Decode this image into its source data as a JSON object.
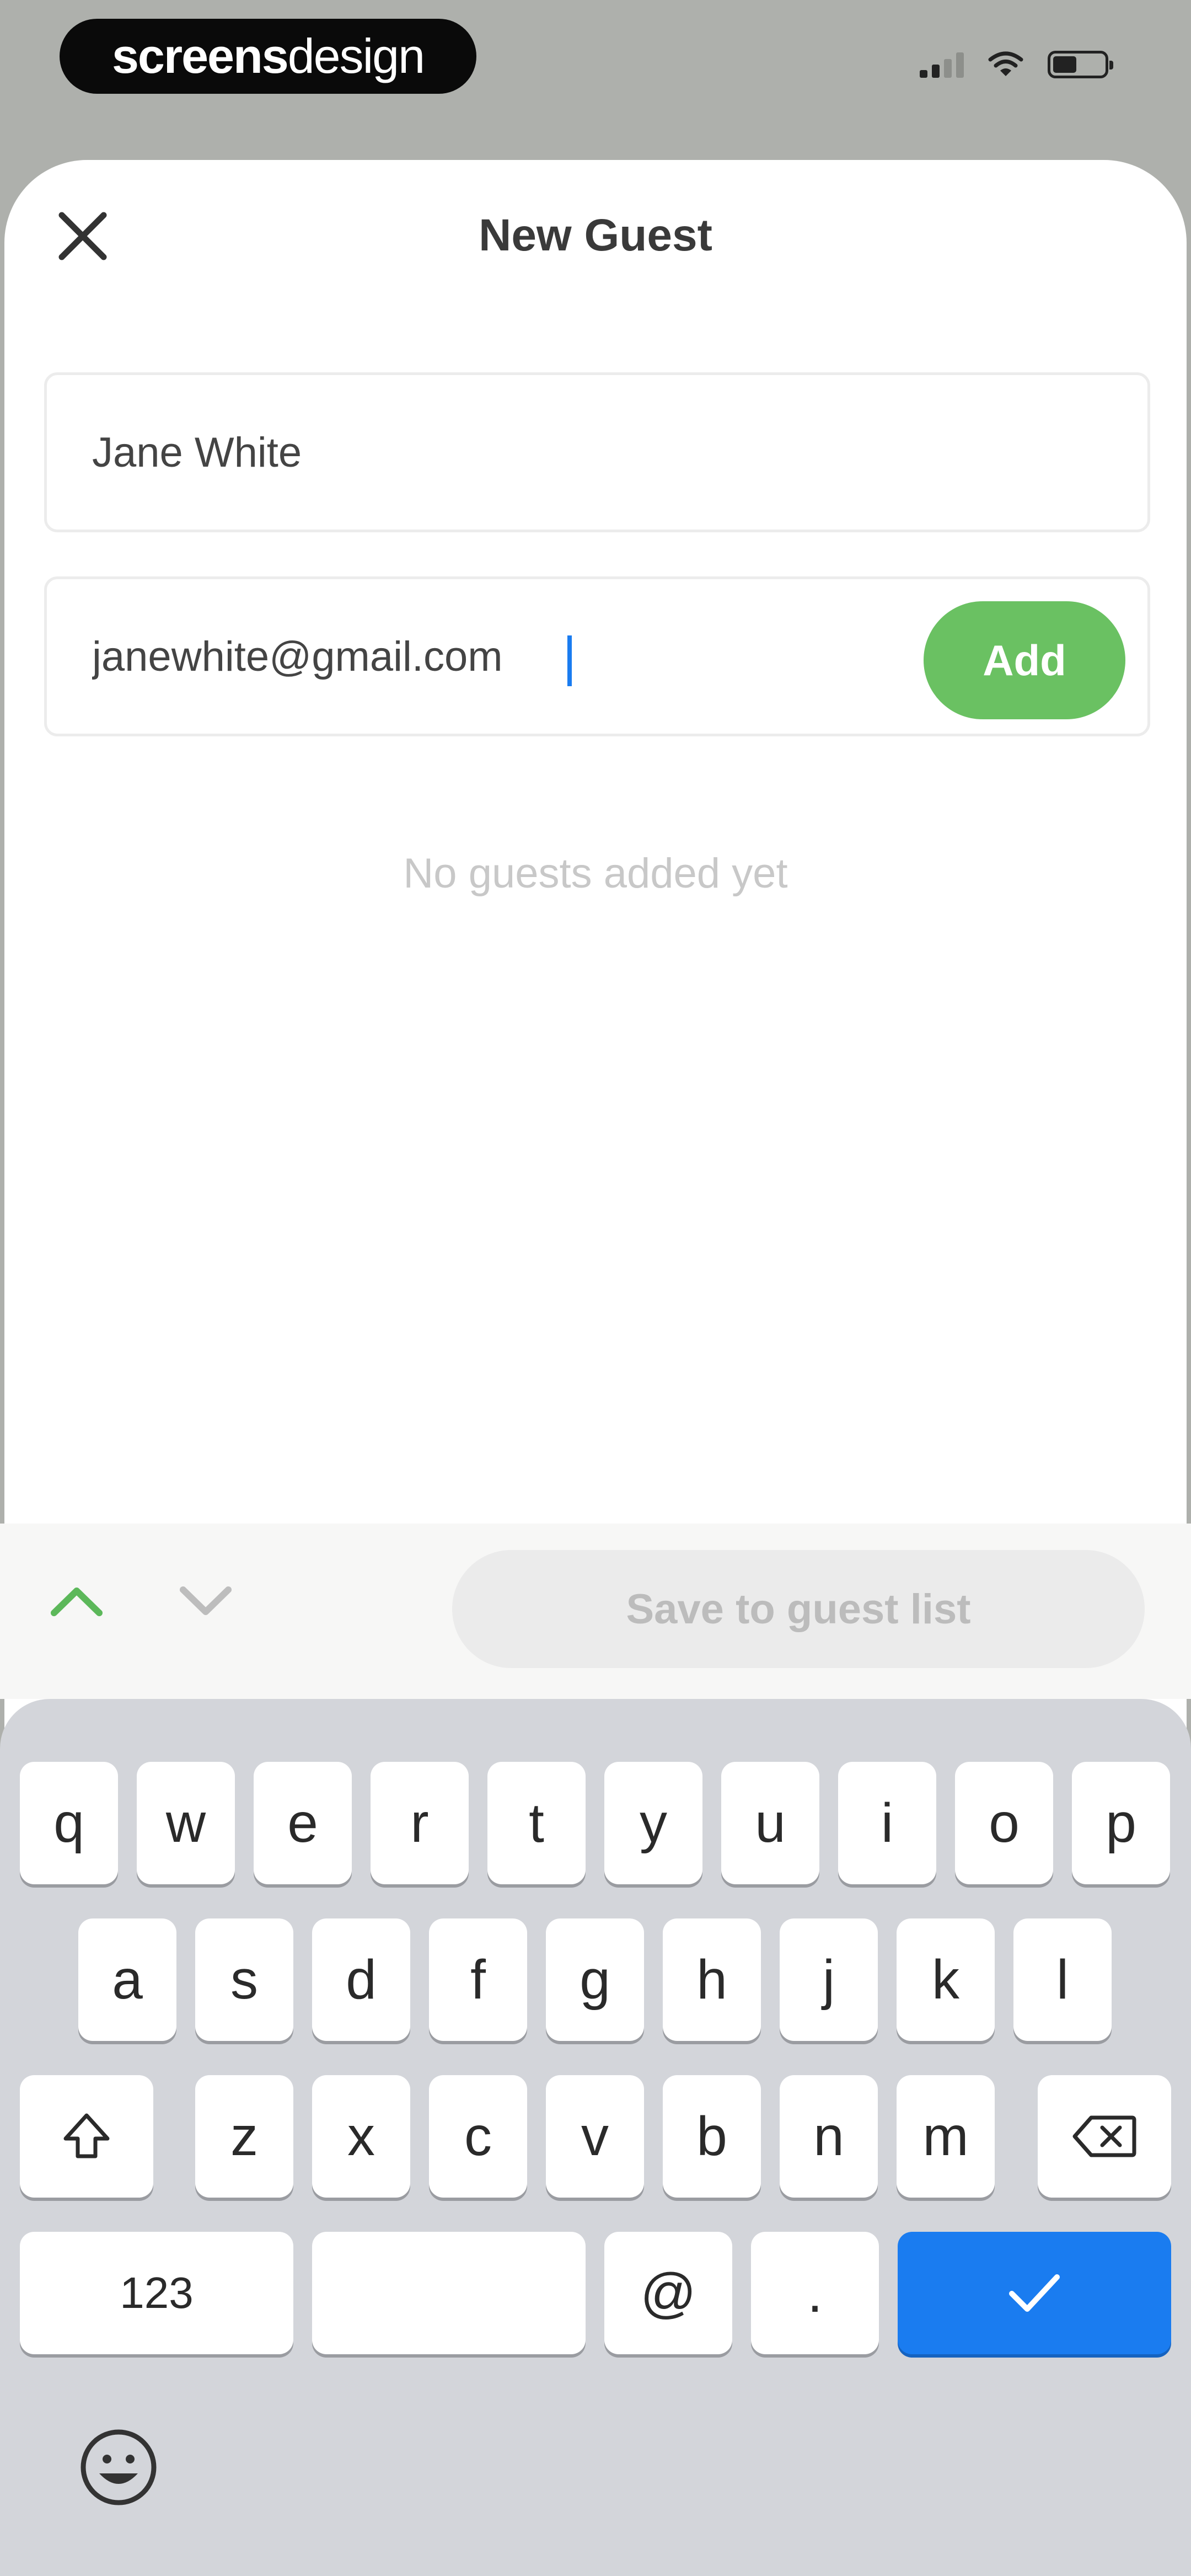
{
  "status_bar": {
    "brand_bold": "screens",
    "brand_light": "design",
    "signal_bars": 2,
    "battery_level_fraction": 0.5,
    "icons": [
      "cellular-signal-icon",
      "wifi-icon",
      "battery-icon"
    ]
  },
  "header": {
    "title": "New Guest",
    "close_icon": "close-icon"
  },
  "form": {
    "name_value": "Jane White",
    "email_value": "janewhite@gmail.com",
    "add_label": "Add"
  },
  "empty_state": "No guests added yet",
  "toolbar": {
    "prev_icon": "chevron-up-icon",
    "next_icon": "chevron-down-icon",
    "save_label": "Save to guest list"
  },
  "keyboard": {
    "row1": [
      "q",
      "w",
      "e",
      "r",
      "t",
      "y",
      "u",
      "i",
      "o",
      "p"
    ],
    "row2": [
      "a",
      "s",
      "d",
      "f",
      "g",
      "h",
      "j",
      "k",
      "l"
    ],
    "row3": [
      "z",
      "x",
      "c",
      "v",
      "b",
      "n",
      "m"
    ],
    "row4": {
      "numbers": "123",
      "at": "@",
      "dot": "."
    },
    "icons": [
      "shift-icon",
      "backspace-icon",
      "checkmark-icon",
      "emoji-icon"
    ]
  },
  "colors": {
    "accent_green": "#6ac162",
    "keyboard_blue": "#1a7cf0",
    "sheet_bg": "#ffffff",
    "keyboard_bg": "#d3d5da"
  }
}
